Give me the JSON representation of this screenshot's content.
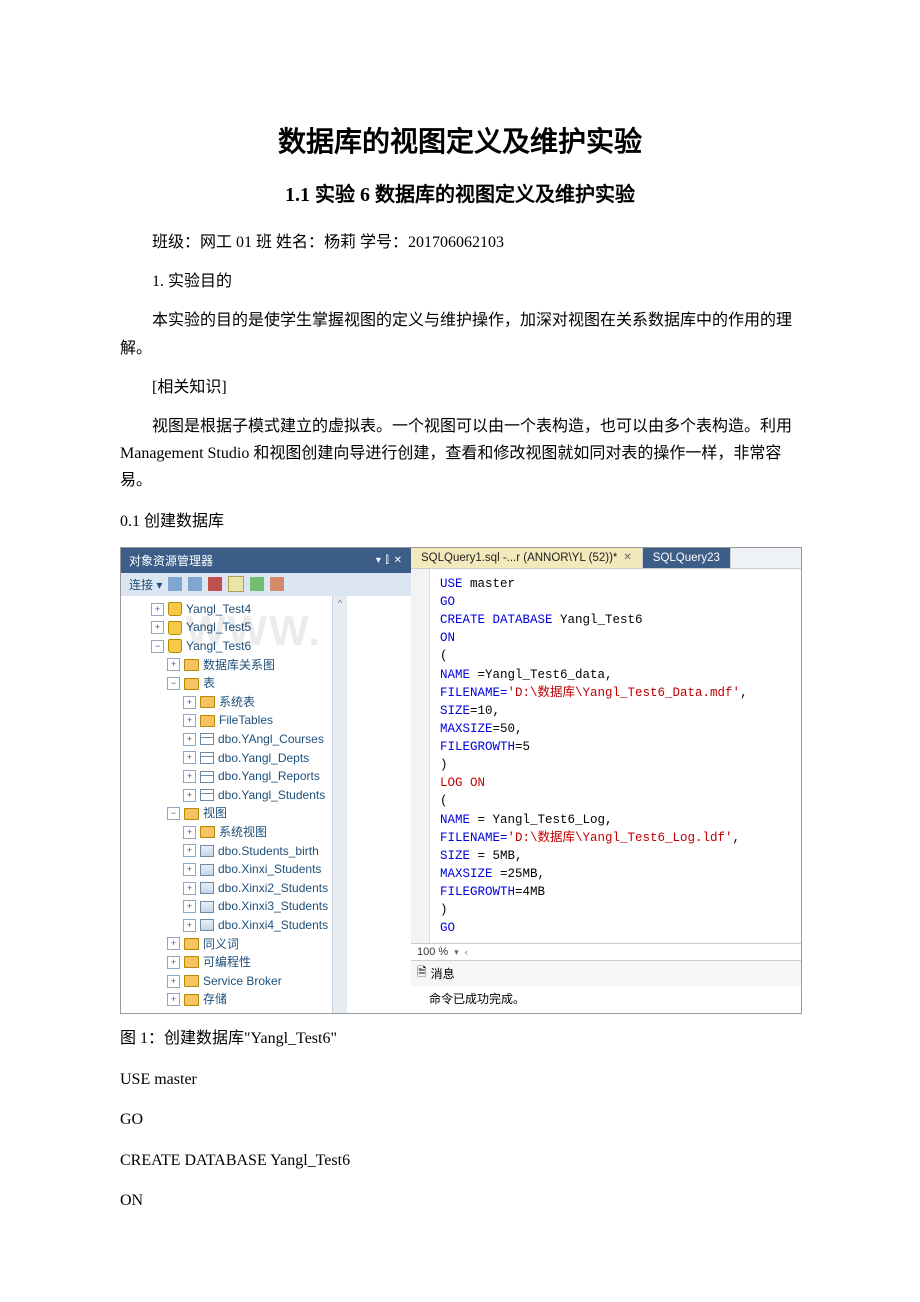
{
  "doc": {
    "title": "数据库的视图定义及维护实验",
    "subtitle": "1.1 实验 6 数据库的视图定义及维护实验",
    "info_line": "班级：网工 01 班 姓名：杨莉 学号：201706062103",
    "p1": "1. 实验目的",
    "p2": "本实验的目的是使学生掌握视图的定义与维护操作，加深对视图在关系数据库中的作用的理解。",
    "p3": "[相关知识]",
    "p4": "视图是根据子模式建立的虚拟表。一个视图可以由一个表构造，也可以由多个表构造。利用 Management Studio 和视图创建向导进行创建，查看和修改视图就如同对表的操作一样，非常容易。",
    "p5": "0.1 创建数据库",
    "caption": "图 1：创建数据库\"Yangl_Test6\"",
    "code_after": [
      "USE master",
      "GO",
      "CREATE DATABASE Yangl_Test6",
      "ON"
    ]
  },
  "oe": {
    "title": "对象资源管理器",
    "pin_glyph": "▾ ⫿ ✕",
    "connect_label": "连接 ▾",
    "watermark": "WWW.",
    "tree": [
      {
        "ind": 0,
        "exp": "+",
        "ico": "db",
        "label": "Yangl_Test4"
      },
      {
        "ind": 0,
        "exp": "+",
        "ico": "db",
        "label": "Yangl_Test5"
      },
      {
        "ind": 0,
        "exp": "−",
        "ico": "db",
        "label": "Yangl_Test6"
      },
      {
        "ind": 1,
        "exp": "+",
        "ico": "folder",
        "label": "数据库关系图"
      },
      {
        "ind": 1,
        "exp": "−",
        "ico": "folder",
        "label": "表"
      },
      {
        "ind": 2,
        "exp": "+",
        "ico": "folder",
        "label": "系统表"
      },
      {
        "ind": 2,
        "exp": "+",
        "ico": "folder",
        "label": "FileTables"
      },
      {
        "ind": 2,
        "exp": "+",
        "ico": "table",
        "label": "dbo.YAngl_Courses"
      },
      {
        "ind": 2,
        "exp": "+",
        "ico": "table",
        "label": "dbo.Yangl_Depts"
      },
      {
        "ind": 2,
        "exp": "+",
        "ico": "table",
        "label": "dbo.Yangl_Reports"
      },
      {
        "ind": 2,
        "exp": "+",
        "ico": "table",
        "label": "dbo.Yangl_Students"
      },
      {
        "ind": 1,
        "exp": "−",
        "ico": "folder",
        "label": "视图"
      },
      {
        "ind": 2,
        "exp": "+",
        "ico": "folder",
        "label": "系统视图"
      },
      {
        "ind": 2,
        "exp": "+",
        "ico": "view",
        "label": "dbo.Students_birth"
      },
      {
        "ind": 2,
        "exp": "+",
        "ico": "view",
        "label": "dbo.Xinxi_Students"
      },
      {
        "ind": 2,
        "exp": "+",
        "ico": "view",
        "label": "dbo.Xinxi2_Students"
      },
      {
        "ind": 2,
        "exp": "+",
        "ico": "view",
        "label": "dbo.Xinxi3_Students"
      },
      {
        "ind": 2,
        "exp": "+",
        "ico": "view",
        "label": "dbo.Xinxi4_Students"
      },
      {
        "ind": 1,
        "exp": "+",
        "ico": "folder",
        "label": "同义词"
      },
      {
        "ind": 1,
        "exp": "+",
        "ico": "folder",
        "label": "可编程性"
      },
      {
        "ind": 1,
        "exp": "+",
        "ico": "folder2",
        "label": "Service Broker"
      },
      {
        "ind": 1,
        "exp": "+",
        "ico": "folder",
        "label": "存储"
      }
    ]
  },
  "tabs": {
    "active": "SQLQuery1.sql -...r (ANNOR\\YL (52))*",
    "other": "SQLQuery23"
  },
  "sql": {
    "lines": [
      {
        "t": "USE",
        "cls": "kw"
      },
      {
        "t": " master\n"
      },
      {
        "t": "GO\n",
        "cls": "kw"
      },
      {
        "t": "CREATE DATABASE",
        "cls": "kw"
      },
      {
        "t": " Yangl_Test6\n"
      },
      {
        "t": "ON\n",
        "cls": "kw"
      },
      {
        "t": "(\n"
      },
      {
        "t": "NAME ",
        "cls": "kw"
      },
      {
        "t": "=Yangl_Test6_data,\n"
      },
      {
        "t": "FILENAME=",
        "cls": "kw"
      },
      {
        "t": "'D:\\数据库\\Yangl_Test6_Data.mdf'",
        "cls": "str"
      },
      {
        "t": ",\n"
      },
      {
        "t": "SIZE",
        "cls": "kw"
      },
      {
        "t": "=10,\n"
      },
      {
        "t": "MAXSIZE",
        "cls": "kw"
      },
      {
        "t": "=50,\n"
      },
      {
        "t": "FILEGROWTH",
        "cls": "kw"
      },
      {
        "t": "=5\n"
      },
      {
        "t": ")\n"
      },
      {
        "t": "LOG ON\n",
        "cls": "str"
      },
      {
        "t": "(\n"
      },
      {
        "t": "NAME ",
        "cls": "kw"
      },
      {
        "t": "= Yangl_Test6_Log,\n"
      },
      {
        "t": "FILENAME=",
        "cls": "kw"
      },
      {
        "t": "'D:\\数据库\\Yangl_Test6_Log.ldf'",
        "cls": "str"
      },
      {
        "t": ",\n"
      },
      {
        "t": "SIZE ",
        "cls": "kw"
      },
      {
        "t": "= 5MB,\n"
      },
      {
        "t": "MAXSIZE ",
        "cls": "kw"
      },
      {
        "t": "=25MB,\n"
      },
      {
        "t": "FILEGROWTH",
        "cls": "kw"
      },
      {
        "t": "=4MB\n"
      },
      {
        "t": ")\n"
      },
      {
        "t": "GO",
        "cls": "kw"
      }
    ]
  },
  "footer": {
    "zoom": "100 %",
    "msg_tab": "消息",
    "msg_body": "命令已成功完成。"
  }
}
